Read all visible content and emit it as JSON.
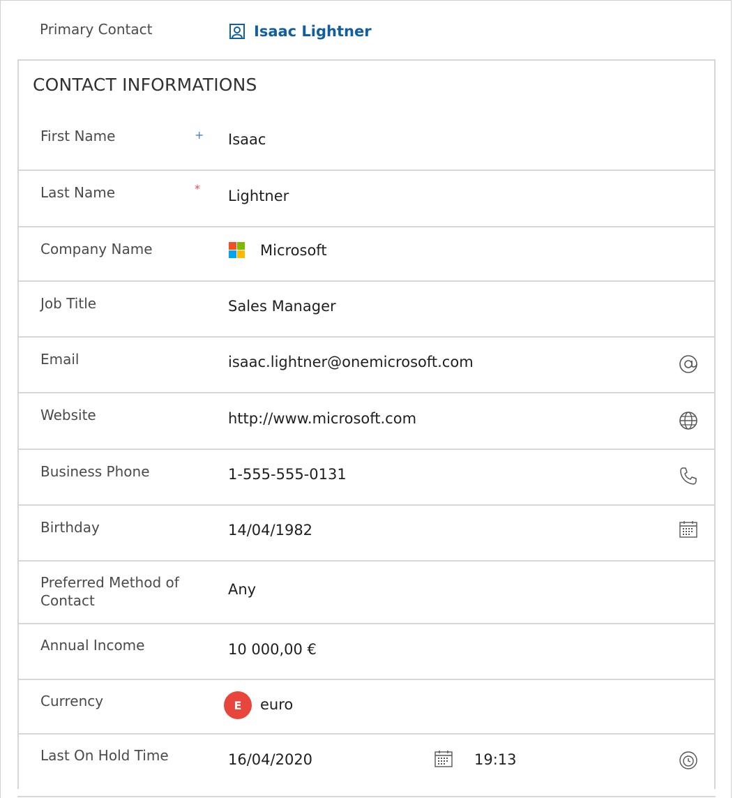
{
  "primary_contact": {
    "label": "Primary Contact",
    "name": "Isaac Lightner"
  },
  "section": {
    "title": "CONTACT INFORMATIONS",
    "fields": {
      "first_name": {
        "label": "First Name",
        "indicator": "+",
        "value": "Isaac"
      },
      "last_name": {
        "label": "Last Name",
        "indicator": "*",
        "value": "Lightner"
      },
      "company_name": {
        "label": "Company Name",
        "value": "Microsoft",
        "icon": "microsoft-logo"
      },
      "job_title": {
        "label": "Job Title",
        "value": "Sales Manager"
      },
      "email": {
        "label": "Email",
        "value": "isaac.lightner@onemicrosoft.com",
        "icon": "at-icon"
      },
      "website": {
        "label": "Website",
        "value": "http://www.microsoft.com",
        "icon": "globe-icon"
      },
      "business_phone": {
        "label": "Business Phone",
        "value": "1-555-555-0131",
        "icon": "phone-icon"
      },
      "birthday": {
        "label": "Birthday",
        "value": "14/04/1982",
        "icon": "calendar-icon"
      },
      "preferred_method": {
        "label_line1": "Preferred Method of",
        "label_line2": "Contact",
        "value": "Any"
      },
      "annual_income": {
        "label": "Annual Income",
        "value": "10 000,00 €"
      },
      "currency": {
        "label": "Currency",
        "badge": "E",
        "value": "euro"
      },
      "last_on_hold_time": {
        "label": "Last On Hold Time",
        "date": "16/04/2020",
        "time": "19:13",
        "date_icon": "calendar-icon",
        "time_icon": "clock-icon"
      }
    }
  },
  "colors": {
    "link": "#115ea3",
    "required": "#e05050",
    "recommended": "#4a7fc1",
    "badge": "#e8453c",
    "border": "#d6d6d6"
  }
}
